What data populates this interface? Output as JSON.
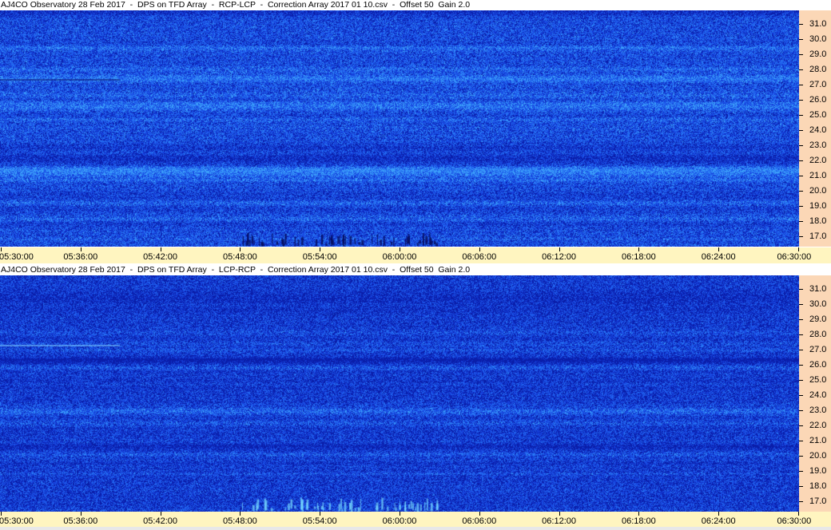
{
  "panels": [
    {
      "title": "AJ4CO Observatory 28 Feb 2017  -  DPS on TFD Array  -  RCP-LCP  -  Correction Array 2017 01 10.csv  -  Offset 50  Gain 2.0",
      "polarization": "RCP-LCP",
      "base_color": "#2f6ae6"
    },
    {
      "title": "AJ4CO Observatory 28 Feb 2017  -  DPS on TFD Array  -  LCP-RCP  -  Correction Array 2017 01 10.csv  -  Offset 50  Gain 2.0",
      "polarization": "LCP-RCP",
      "base_color": "#2246d8"
    }
  ],
  "y_axis": {
    "unit": "MHz",
    "min": 16.3,
    "max": 31.9,
    "ticks": [
      "31.0",
      "30.0",
      "29.0",
      "28.0",
      "27.0",
      "26.0",
      "25.0",
      "24.0",
      "23.0",
      "22.0",
      "21.0",
      "20.0",
      "19.0",
      "18.0",
      "17.0"
    ]
  },
  "x_axis": {
    "start": "05:30:00",
    "end": "06:30:00",
    "ticks": [
      "05:30:00",
      "05:36:00",
      "05:42:00",
      "05:48:00",
      "05:54:00",
      "06:00:00",
      "06:06:00",
      "06:12:00",
      "06:18:00",
      "06:24:00",
      "06:30:00"
    ]
  },
  "colors": {
    "y_axis_bg": "#fbd7b6",
    "x_axis_bg": "#fff5c0"
  }
}
